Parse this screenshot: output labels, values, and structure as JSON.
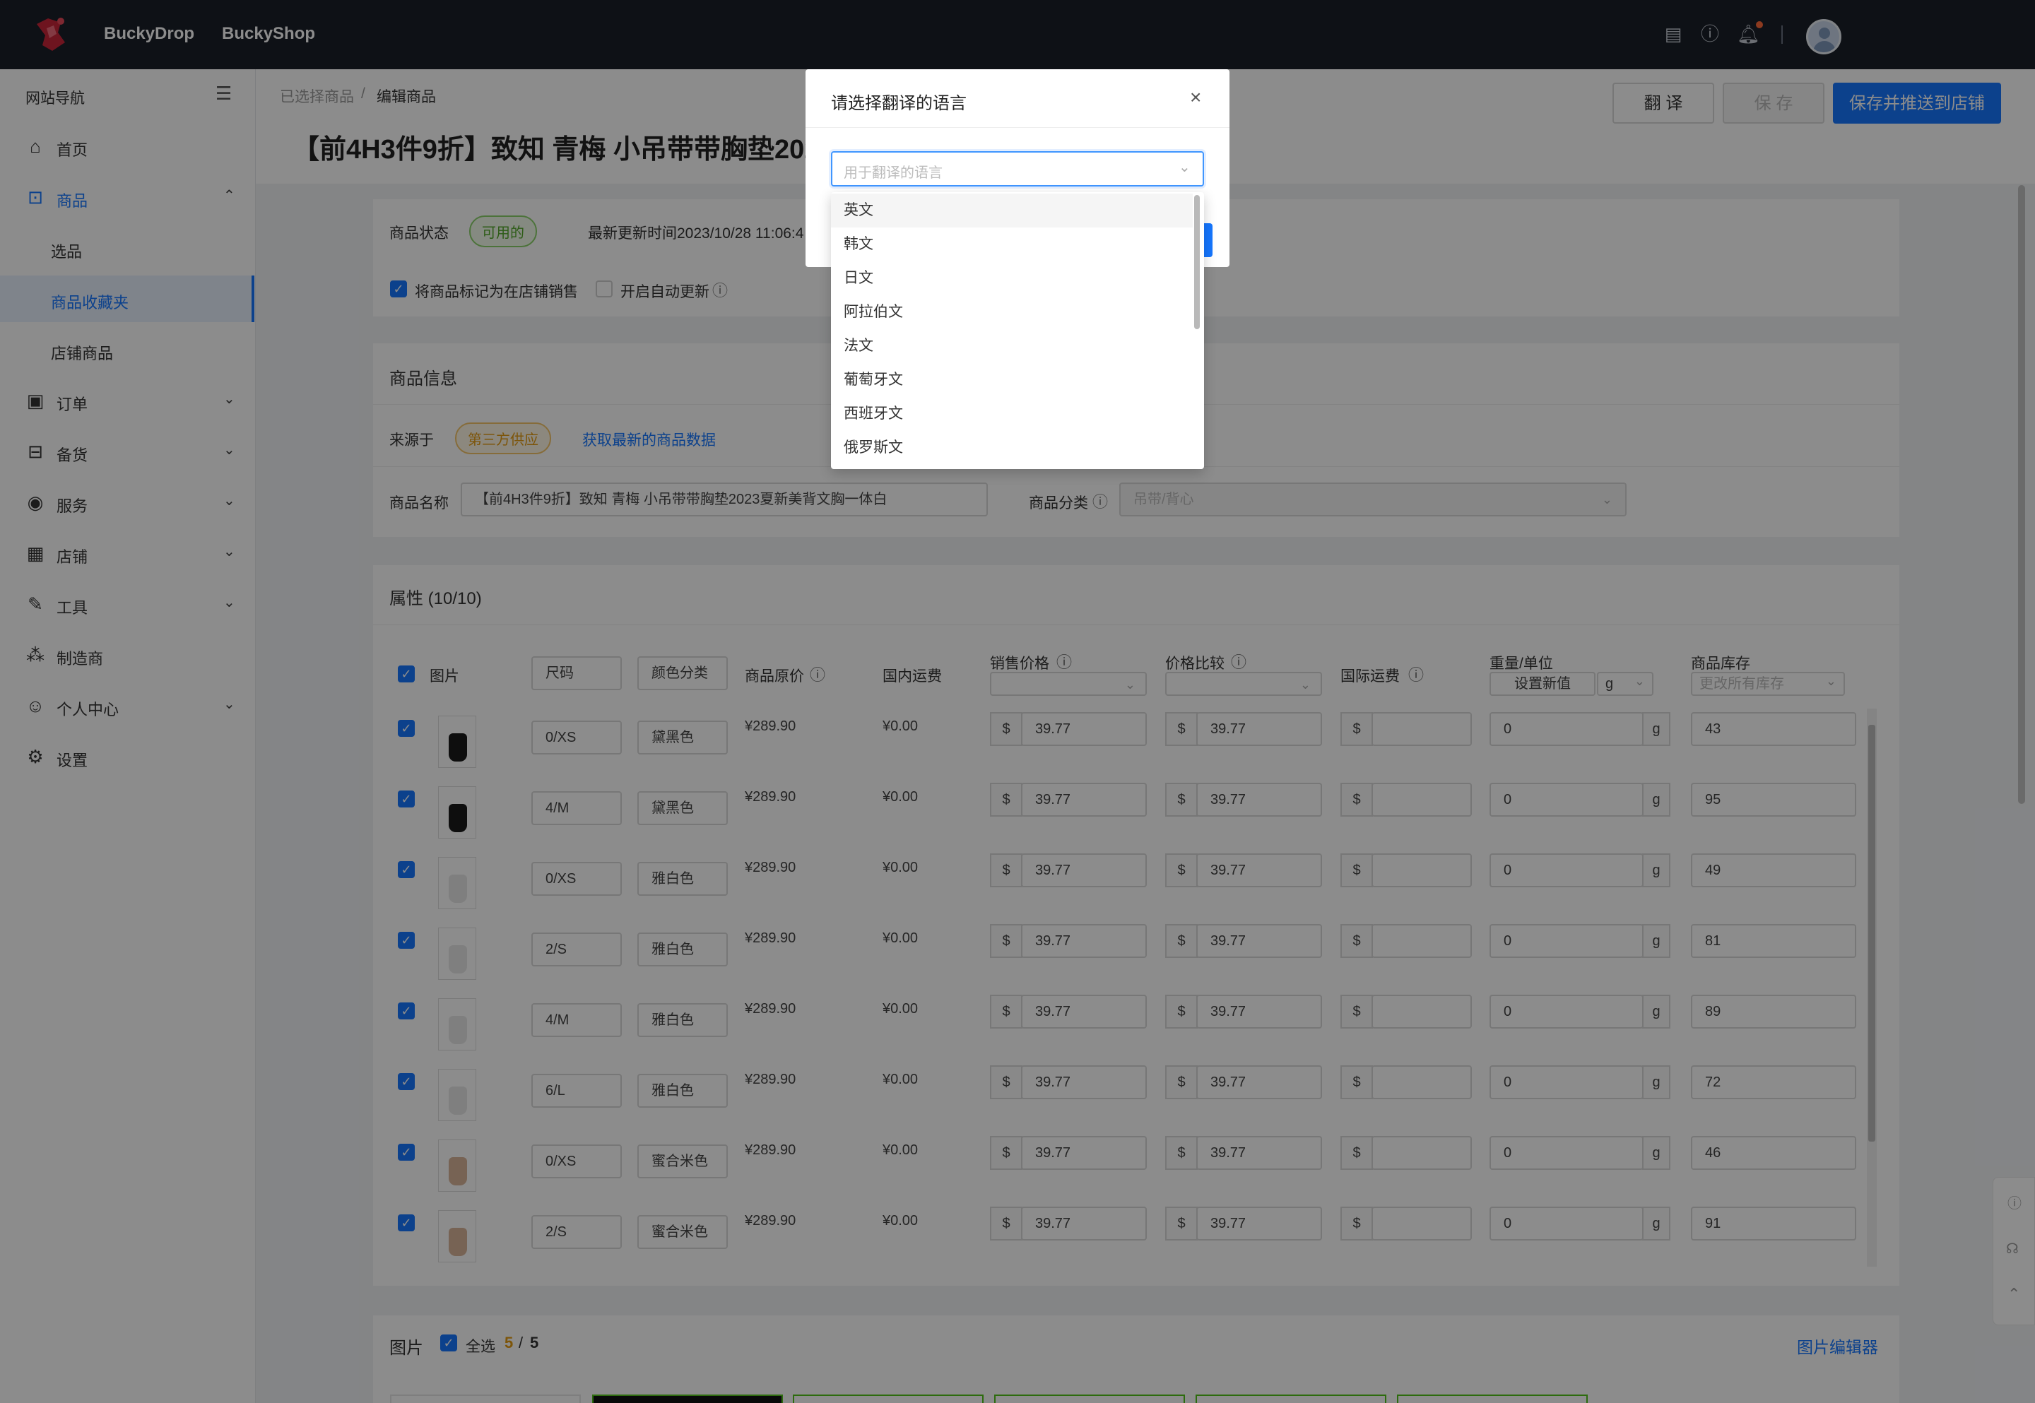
{
  "topbar": {
    "brand1": "BuckyDrop",
    "brand2": "BuckyShop",
    "icons": [
      "document-icon",
      "help-icon",
      "bell-icon"
    ]
  },
  "sidebar": {
    "title": "网站导航",
    "items": [
      {
        "label": "首页",
        "icon": "home-icon"
      },
      {
        "label": "商品",
        "icon": "bag-icon"
      },
      {
        "label": "选品"
      },
      {
        "label": "商品收藏夹"
      },
      {
        "label": "店铺商品"
      },
      {
        "label": "订单",
        "icon": "order-icon"
      },
      {
        "label": "备货",
        "icon": "box-icon"
      },
      {
        "label": "服务",
        "icon": "service-icon"
      },
      {
        "label": "店铺",
        "icon": "store-icon"
      },
      {
        "label": "工具",
        "icon": "wrench-icon"
      },
      {
        "label": "制造商",
        "icon": "network-icon"
      },
      {
        "label": "个人中心",
        "icon": "user-icon"
      },
      {
        "label": "设置",
        "icon": "gear-icon"
      }
    ]
  },
  "breadcrumb": {
    "first": "已选择商品",
    "sep": "/",
    "current": "编辑商品"
  },
  "page_title": "【前4H3件9折】致知 青梅 小吊带带胸垫2023夏新美背文胸一体白",
  "actions": {
    "translate": "翻 译",
    "save": "保 存",
    "save_push": "保存并推送到店铺"
  },
  "status": {
    "label": "商品状态",
    "tag": "可用的",
    "updated": "最新更新时间2023/10/28 11:06:4",
    "mark_sell": "将商品标记为在店铺销售",
    "auto_update": "开启自动更新"
  },
  "info": {
    "title": "商品信息",
    "source_label": "来源于",
    "source_tag": "第三方供应",
    "fetch_link": "获取最新的商品数据",
    "name_label": "商品名称",
    "name_value": "【前4H3件9折】致知 青梅 小吊带带胸垫2023夏新美背文胸一体白",
    "category_label": "商品分类",
    "category_value": "吊带/背心"
  },
  "attrs": {
    "title": "属性 (10/10)",
    "headers": {
      "image": "图片",
      "size": "尺码",
      "color": "颜色分类",
      "orig_price": "商品原价",
      "domestic": "国内运费",
      "sale_price": "销售价格",
      "compare": "价格比较",
      "intl": "国际运费",
      "weight": "重量/单位",
      "set_new": "设置新值",
      "unit": "g",
      "stock": "商品库存",
      "stock_placeholder": "更改所有库存"
    },
    "rows": [
      {
        "size": "0/XS",
        "color": "黛黑色",
        "orig": "¥289.90",
        "dom": "¥0.00",
        "cur": "$",
        "sale": "39.77",
        "cmp": "39.77",
        "weight": "0",
        "unit": "g",
        "stock": "43",
        "swatch": "#1a1a1a"
      },
      {
        "size": "4/M",
        "color": "黛黑色",
        "orig": "¥289.90",
        "dom": "¥0.00",
        "cur": "$",
        "sale": "39.77",
        "cmp": "39.77",
        "weight": "0",
        "unit": "g",
        "stock": "95",
        "swatch": "#1a1a1a"
      },
      {
        "size": "0/XS",
        "color": "雅白色",
        "orig": "¥289.90",
        "dom": "¥0.00",
        "cur": "$",
        "sale": "39.77",
        "cmp": "39.77",
        "weight": "0",
        "unit": "g",
        "stock": "49",
        "swatch": "#e8e8e8"
      },
      {
        "size": "2/S",
        "color": "雅白色",
        "orig": "¥289.90",
        "dom": "¥0.00",
        "cur": "$",
        "sale": "39.77",
        "cmp": "39.77",
        "weight": "0",
        "unit": "g",
        "stock": "81",
        "swatch": "#e8e8e8"
      },
      {
        "size": "4/M",
        "color": "雅白色",
        "orig": "¥289.90",
        "dom": "¥0.00",
        "cur": "$",
        "sale": "39.77",
        "cmp": "39.77",
        "weight": "0",
        "unit": "g",
        "stock": "89",
        "swatch": "#e8e8e8"
      },
      {
        "size": "6/L",
        "color": "雅白色",
        "orig": "¥289.90",
        "dom": "¥0.00",
        "cur": "$",
        "sale": "39.77",
        "cmp": "39.77",
        "weight": "0",
        "unit": "g",
        "stock": "72",
        "swatch": "#e8e8e8"
      },
      {
        "size": "0/XS",
        "color": "蜜合米色",
        "orig": "¥289.90",
        "dom": "¥0.00",
        "cur": "$",
        "sale": "39.77",
        "cmp": "39.77",
        "weight": "0",
        "unit": "g",
        "stock": "46",
        "swatch": "#d9b59a"
      },
      {
        "size": "2/S",
        "color": "蜜合米色",
        "orig": "¥289.90",
        "dom": "¥0.00",
        "cur": "$",
        "sale": "39.77",
        "cmp": "39.77",
        "weight": "0",
        "unit": "g",
        "stock": "91",
        "swatch": "#d9b59a"
      }
    ]
  },
  "images": {
    "title": "图片",
    "select_all": "全选",
    "count": "5",
    "slash": "/",
    "total": "5",
    "editor_link": "图片编辑器"
  },
  "modal": {
    "title": "请选择翻译的语言",
    "placeholder": "用于翻译的语言",
    "options": [
      "英文",
      "韩文",
      "日文",
      "阿拉伯文",
      "法文",
      "葡萄牙文",
      "西班牙文",
      "俄罗斯文"
    ]
  },
  "colors": {
    "primary": "#1677ff",
    "topbar": "#1b2029",
    "success": "#52a828",
    "warning": "#e49b12"
  }
}
